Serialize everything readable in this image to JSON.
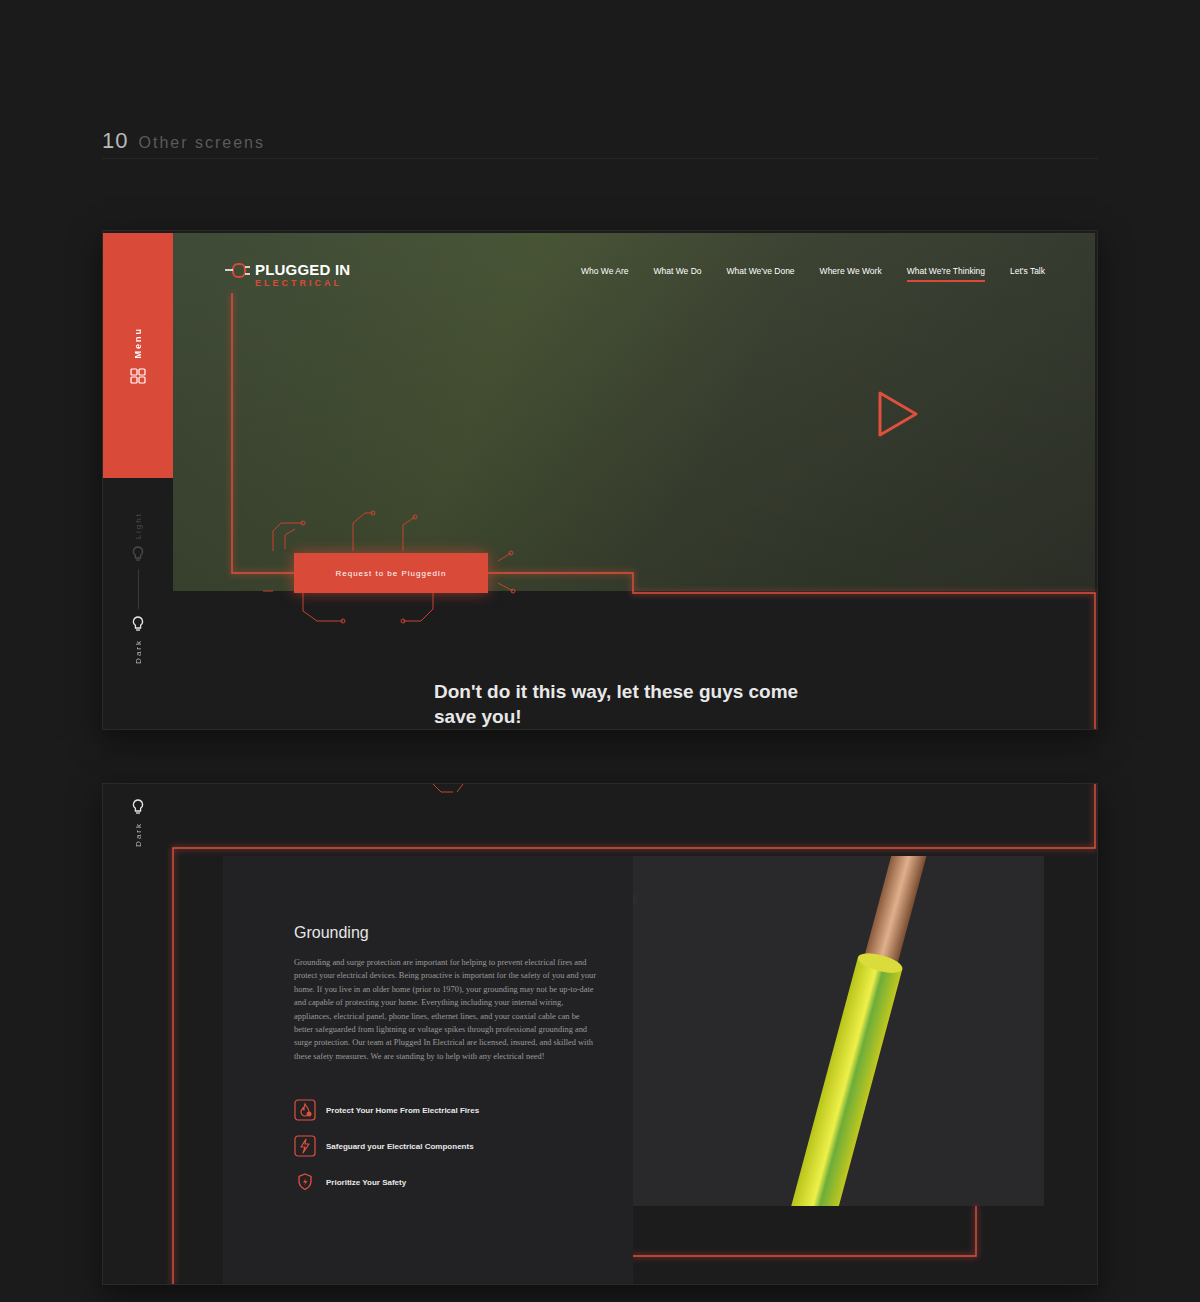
{
  "section": {
    "number": "10",
    "title": "Other screens"
  },
  "screen1": {
    "logo": {
      "name": "PLUGGED IN",
      "tagline": "ELECTRICAL"
    },
    "sidebar": {
      "menu": "Menu",
      "theme": [
        {
          "label": "Light",
          "selected": false
        },
        {
          "label": "Dark",
          "selected": true
        }
      ]
    },
    "nav": [
      {
        "label": "Who We Are",
        "selected": false
      },
      {
        "label": "What We Do",
        "selected": false
      },
      {
        "label": "What We've Done",
        "selected": false
      },
      {
        "label": "Where We Work",
        "selected": false
      },
      {
        "label": "What We're Thinking",
        "selected": true
      },
      {
        "label": "Let's Talk",
        "selected": false
      }
    ],
    "cta": "Request to be PluggedIn",
    "headline": "Don't do it this way, let these guys come save you!"
  },
  "screen2": {
    "sidebar": {
      "theme": [
        {
          "label": "Dark",
          "selected": true
        }
      ]
    },
    "title": "Grounding",
    "body": "Grounding and surge protection are important for helping to prevent electrical fires and protect your electrical devices. Being proactive is important for the safety of you and your home. If you live in an older home (prior to 1970), your grounding may not be up-to-date and capable of protecting your home. Everything including your internal wiring, appliances, electrical panel, phone lines, ethernet lines, and your coaxial cable can be better safeguarded from lightning or voltage spikes through professional grounding and surge protection. Our team at Plugged In Electrical are licensed, insured, and skilled with these safety measures. We are standing by to help with any electrical need!",
    "features": [
      {
        "label": "Protect Your Home From Electrical Fires",
        "kind": "fire"
      },
      {
        "label": "Safeguard your Electrical Components",
        "kind": "bolt"
      },
      {
        "label": "Prioritize Your Safety",
        "kind": "shield"
      }
    ]
  }
}
